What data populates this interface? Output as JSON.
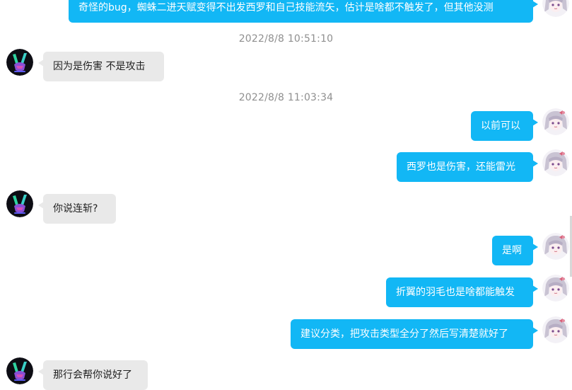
{
  "messages": [
    {
      "text": "奇怪的bug，蜘蛛二进天赋变得不出发西罗和自己技能流矢，估计是啥都不触发了，但其他没测"
    },
    {
      "timestamp": "2022/8/8 10:51:10"
    },
    {
      "text": "因为是伤害  不是攻击"
    },
    {
      "timestamp": "2022/8/8 11:03:34"
    },
    {
      "text": "以前可以"
    },
    {
      "text": "西罗也是伤害，还能雷光"
    },
    {
      "text": "你说连斩?"
    },
    {
      "text": "是啊"
    },
    {
      "text": "折翼的羽毛也是啥都能触发"
    },
    {
      "text": "建议分类，把攻击类型全分了然后写清楚就好了"
    },
    {
      "text": "那行会帮你说好了"
    }
  ],
  "colors": {
    "outgoing_bubble": "#12b7f5",
    "incoming_bubble": "#e9e9e9",
    "timestamp_text": "#8f8f8f"
  },
  "icons": {
    "other_avatar": "victory-hand-avatar-icon",
    "self_avatar": "anime-character-avatar-icon"
  }
}
